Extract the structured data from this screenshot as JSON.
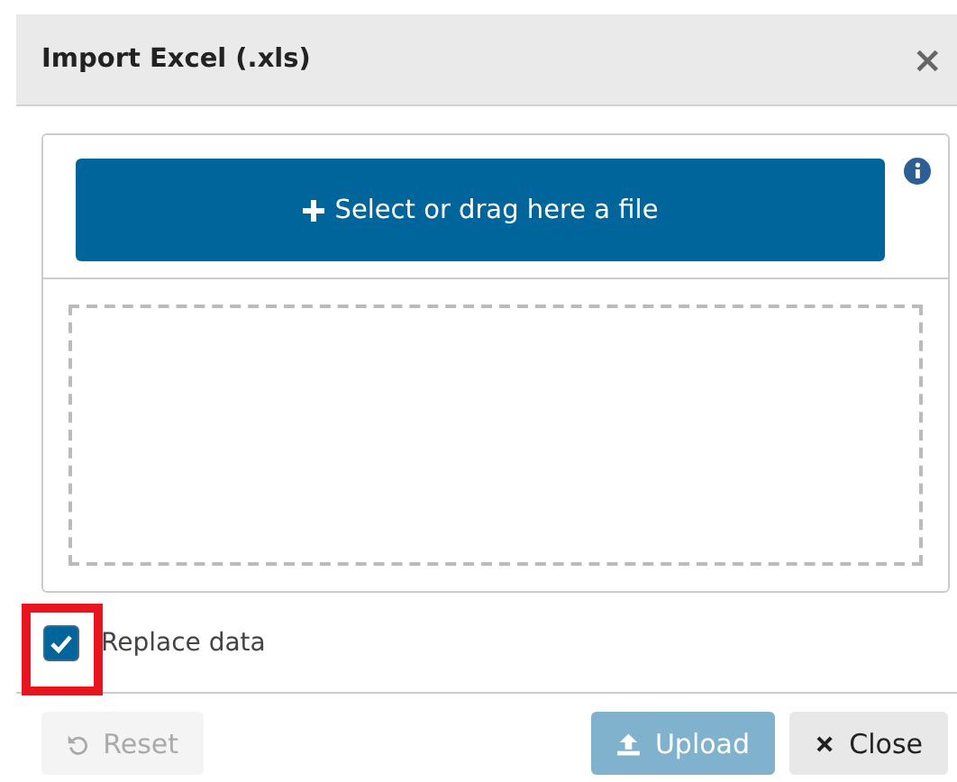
{
  "window": {
    "title": "Import Excel (.xls)",
    "close": "×"
  },
  "uploader": {
    "select_label": "Select or drag here a file"
  },
  "replace": {
    "label": "Replace data",
    "checked": true,
    "highlighted": true
  },
  "buttons": [
    {
      "kind": "reset",
      "label": "Reset",
      "disabled": true
    },
    {
      "kind": "upload",
      "label": "Upload",
      "disabled": true
    },
    {
      "kind": "close",
      "label": "Close",
      "disabled": false
    }
  ]
}
